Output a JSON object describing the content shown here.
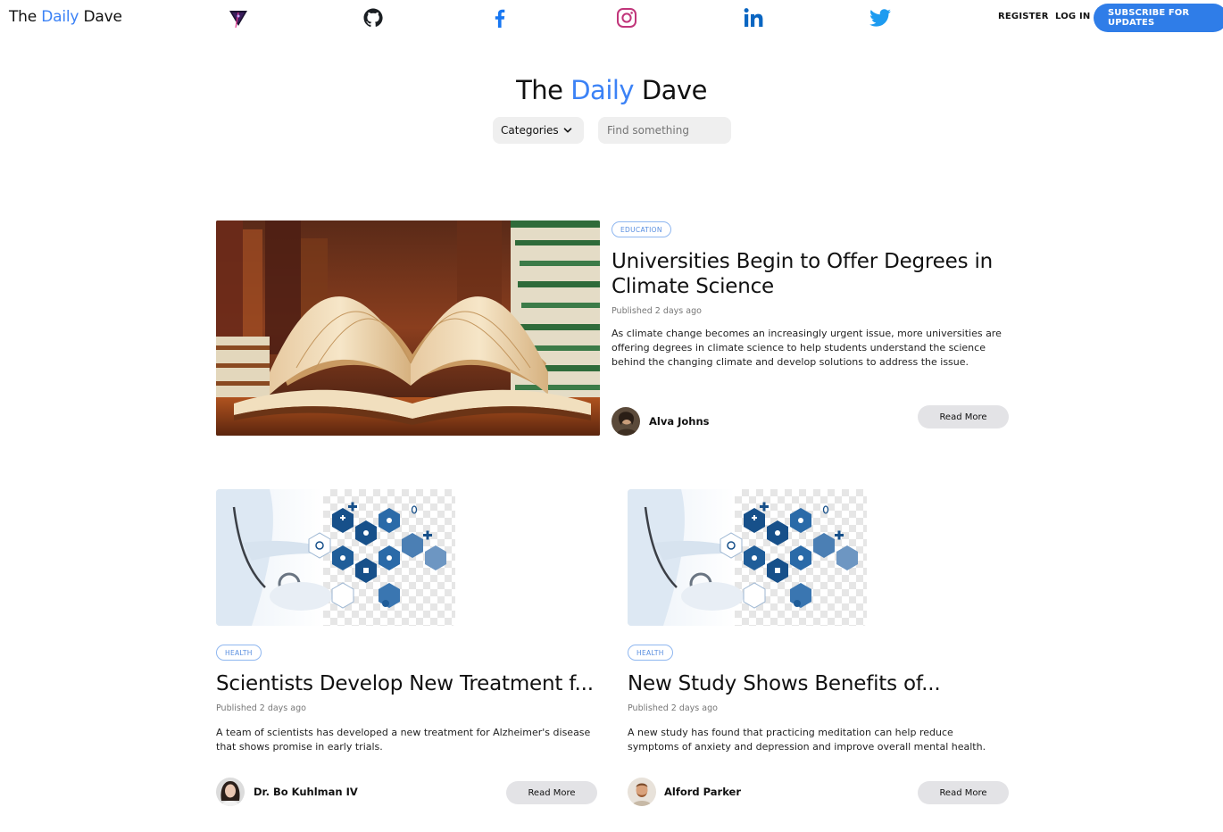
{
  "nav": {
    "brand_pre": "The",
    "brand_accent": "Daily",
    "brand_post": "Dave",
    "register": "REGISTER",
    "login": "LOG IN",
    "subscribe": "SUBSCRIBE FOR UPDATES",
    "social_icons": [
      "logo-triangle-icon",
      "github-icon",
      "facebook-icon",
      "instagram-icon",
      "linkedin-icon",
      "twitter-icon"
    ]
  },
  "hero": {
    "title_pre": "The",
    "title_accent": "Daily",
    "title_post": "Dave",
    "categories_label": "Categories",
    "search_placeholder": "Find something"
  },
  "colors": {
    "accent": "#3b82f6",
    "subscribe_bg": "#2f7de8",
    "tag_border": "#8fb7f0",
    "button_bg": "#e3e3e6"
  },
  "featured": {
    "tag": "EDUCATION",
    "title_line1": "Universities Begin to Offer Degrees in",
    "title_line2": "Climate Science",
    "published": "Published 2 days ago",
    "excerpt": "As climate change becomes an increasingly urgent issue, more universities are offering degrees in climate science to help students understand the science behind the changing climate and develop solutions to address the issue.",
    "author": "Alva Johns",
    "read_more": "Read More"
  },
  "posts": [
    {
      "tag": "HEALTH",
      "title": "Scientists Develop New Treatment f...",
      "published": "Published 2 days ago",
      "excerpt": "A team of scientists has developed a new treatment for Alzheimer's disease that shows promise in early trials.",
      "author": "Dr. Bo Kuhlman IV",
      "read_more": "Read More"
    },
    {
      "tag": "HEALTH",
      "title": "New Study Shows Benefits of...",
      "published": "Published 2 days ago",
      "excerpt": "A new study has found that practicing meditation can help reduce symptoms of anxiety and depression and improve overall mental health.",
      "author": "Alford Parker",
      "read_more": "Read More"
    }
  ]
}
